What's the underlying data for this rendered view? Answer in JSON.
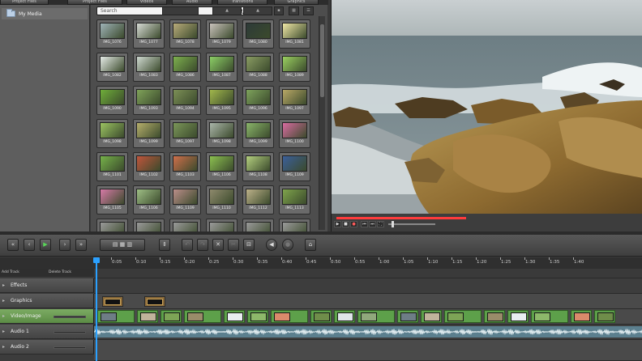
{
  "tabs": [
    "Project Files",
    "Project Files",
    "Videos",
    "Audio",
    "Transitions",
    "Graphics"
  ],
  "folders": [
    {
      "label": "My Media"
    }
  ],
  "search": {
    "placeholder": "Search"
  },
  "media_items": [
    {
      "label": "IMG_1076",
      "color": "#9fb3b8"
    },
    {
      "label": "IMG_1077",
      "color": "#d7dbd5"
    },
    {
      "label": "IMG_1078",
      "color": "#b8ab7a"
    },
    {
      "label": "IMG_1079",
      "color": "#c9c2bc"
    },
    {
      "label": "IMG_1080",
      "color": "#2d3a38"
    },
    {
      "label": "IMG_1081",
      "color": "#f1e8a6"
    },
    {
      "label": "IMG_1082",
      "color": "#e6ece8"
    },
    {
      "label": "IMG_1083",
      "color": "#cfd9d1"
    },
    {
      "label": "IMG_1086",
      "color": "#7db04e"
    },
    {
      "label": "IMG_1087",
      "color": "#8ccf66"
    },
    {
      "label": "IMG_1088",
      "color": "#8a9c63"
    },
    {
      "label": "IMG_1089",
      "color": "#9ad060"
    },
    {
      "label": "IMG_1090",
      "color": "#6fae3a"
    },
    {
      "label": "IMG_1093",
      "color": "#80a35a"
    },
    {
      "label": "IMG_1094",
      "color": "#7c8f56"
    },
    {
      "label": "IMG_1095",
      "color": "#a2b84c"
    },
    {
      "label": "IMG_1096",
      "color": "#7ea35c"
    },
    {
      "label": "IMG_1097",
      "color": "#b9a866"
    },
    {
      "label": "IMG_1098",
      "color": "#9cc462"
    },
    {
      "label": "IMG_1099",
      "color": "#b6af6c"
    },
    {
      "label": "IMG_1097",
      "color": "#7b9659"
    },
    {
      "label": "IMG_1098",
      "color": "#aab5a9"
    },
    {
      "label": "IMG_1099",
      "color": "#8ab56a"
    },
    {
      "label": "IMG_1100",
      "color": "#d86ca0"
    },
    {
      "label": "IMG_1101",
      "color": "#76b24a"
    },
    {
      "label": "IMG_1102",
      "color": "#c0553c"
    },
    {
      "label": "IMG_1103",
      "color": "#cf6f4b"
    },
    {
      "label": "IMG_1106",
      "color": "#8cc050"
    },
    {
      "label": "IMG_1108",
      "color": "#b4cf7f"
    },
    {
      "label": "IMG_1109",
      "color": "#3b5f9a"
    },
    {
      "label": "IMG_1105",
      "color": "#d77aa7"
    },
    {
      "label": "IMG_1106",
      "color": "#9fbf86"
    },
    {
      "label": "IMG_1109",
      "color": "#bb8e8a"
    },
    {
      "label": "IMG_1110",
      "color": "#8f8a6d"
    },
    {
      "label": "IMG_1112",
      "color": "#bdb28a"
    },
    {
      "label": "IMG_1113",
      "color": "#7fa44c"
    },
    {
      "label": "",
      "color": "#9a9a9a"
    },
    {
      "label": "",
      "color": "#9a9a9a"
    },
    {
      "label": "",
      "color": "#9a9a9a"
    },
    {
      "label": "",
      "color": "#9a9a9a"
    },
    {
      "label": "",
      "color": "#9a9a9a"
    },
    {
      "label": "",
      "color": "#9a9a9a"
    }
  ],
  "timeline": {
    "add_track": "Add Track",
    "delete_track": "Delete Track",
    "ruler_ticks": [
      "0:05",
      "0:10",
      "0:15",
      "0:20",
      "0:25",
      "0:30",
      "0:35",
      "0:40",
      "0:45",
      "0:50",
      "0:55",
      "1:00",
      "1:05",
      "1:10",
      "1:15",
      "1:20",
      "1:25",
      "1:30",
      "1:35",
      "1:40"
    ],
    "tracks": [
      {
        "name": "Effects"
      },
      {
        "name": "Graphics"
      },
      {
        "name": "Video/Image"
      },
      {
        "name": "Audio 1"
      },
      {
        "name": "Audio 2"
      }
    ]
  },
  "colors": {
    "accent": "#2aa0ff",
    "scrub_progress": "#ff3b3b",
    "selected_track": "#6b9e53"
  }
}
